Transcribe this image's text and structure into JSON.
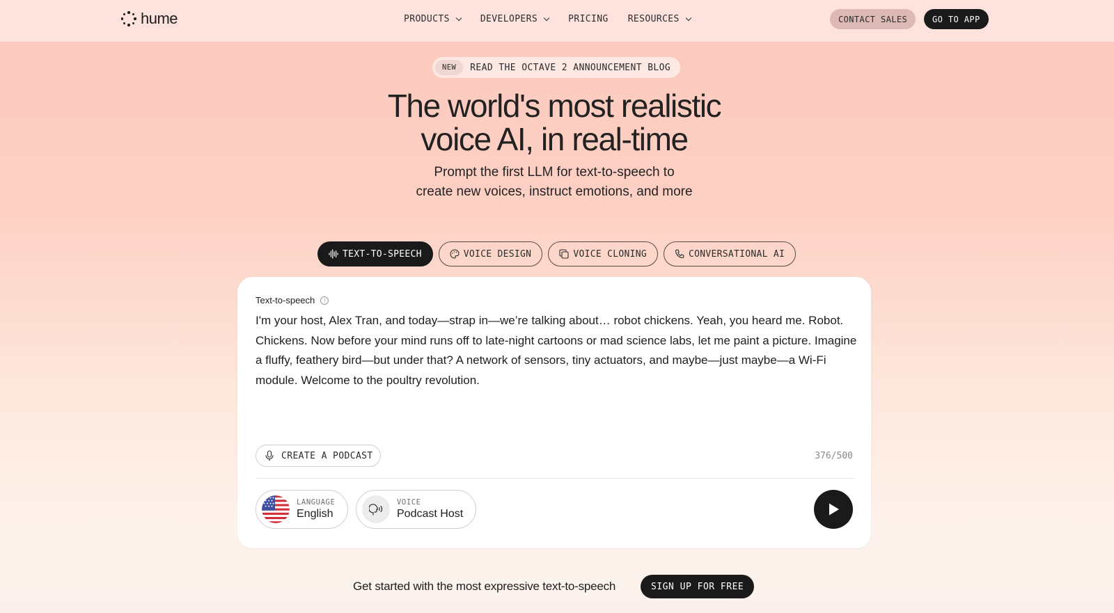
{
  "nav": {
    "logo_text": "hume",
    "links": [
      {
        "label": "PRODUCTS",
        "has_dropdown": true
      },
      {
        "label": "DEVELOPERS",
        "has_dropdown": true
      },
      {
        "label": "PRICING",
        "has_dropdown": false
      },
      {
        "label": "RESOURCES",
        "has_dropdown": true
      }
    ],
    "contact_sales": "CONTACT SALES",
    "go_to_app": "GO TO APP"
  },
  "announcement": {
    "badge": "NEW",
    "text": "READ THE OCTAVE 2 ANNOUNCEMENT BLOG"
  },
  "hero": {
    "title_line1": "The world's most realistic",
    "title_line2": "voice AI, in real-time",
    "subtitle_line1": "Prompt the first LLM for text-to-speech to",
    "subtitle_line2": "create new voices, instruct emotions, and more"
  },
  "tabs": [
    {
      "label": "TEXT-TO-SPEECH",
      "icon": "waveform-icon",
      "active": true
    },
    {
      "label": "VOICE DESIGN",
      "icon": "palette-icon",
      "active": false
    },
    {
      "label": "VOICE CLONING",
      "icon": "copy-icon",
      "active": false
    },
    {
      "label": "CONVERSATIONAL AI",
      "icon": "phone-icon",
      "active": false
    }
  ],
  "card": {
    "label": "Text-to-speech",
    "text": "I'm your host, Alex Tran, and today—strap in—we’re talking about… robot chickens. Yeah, you heard me. Robot. Chickens. Now before your mind runs off to late-night cartoons or mad science labs, let me paint a picture. Imagine a fluffy, feathery bird—but under that? A network of sensors, tiny actuators, and maybe—just maybe—a Wi-Fi module. Welcome to the poultry revolution.",
    "podcast_button": "CREATE A PODCAST",
    "counter": "376/500",
    "language": {
      "small_label": "LANGUAGE",
      "value": "English",
      "icon": "us-flag-icon"
    },
    "voice": {
      "small_label": "VOICE",
      "value": "Podcast Host",
      "icon": "speaking-head-icon"
    }
  },
  "cta": {
    "text": "Get started with the most expressive text-to-speech",
    "button": "SIGN UP FOR FREE"
  }
}
